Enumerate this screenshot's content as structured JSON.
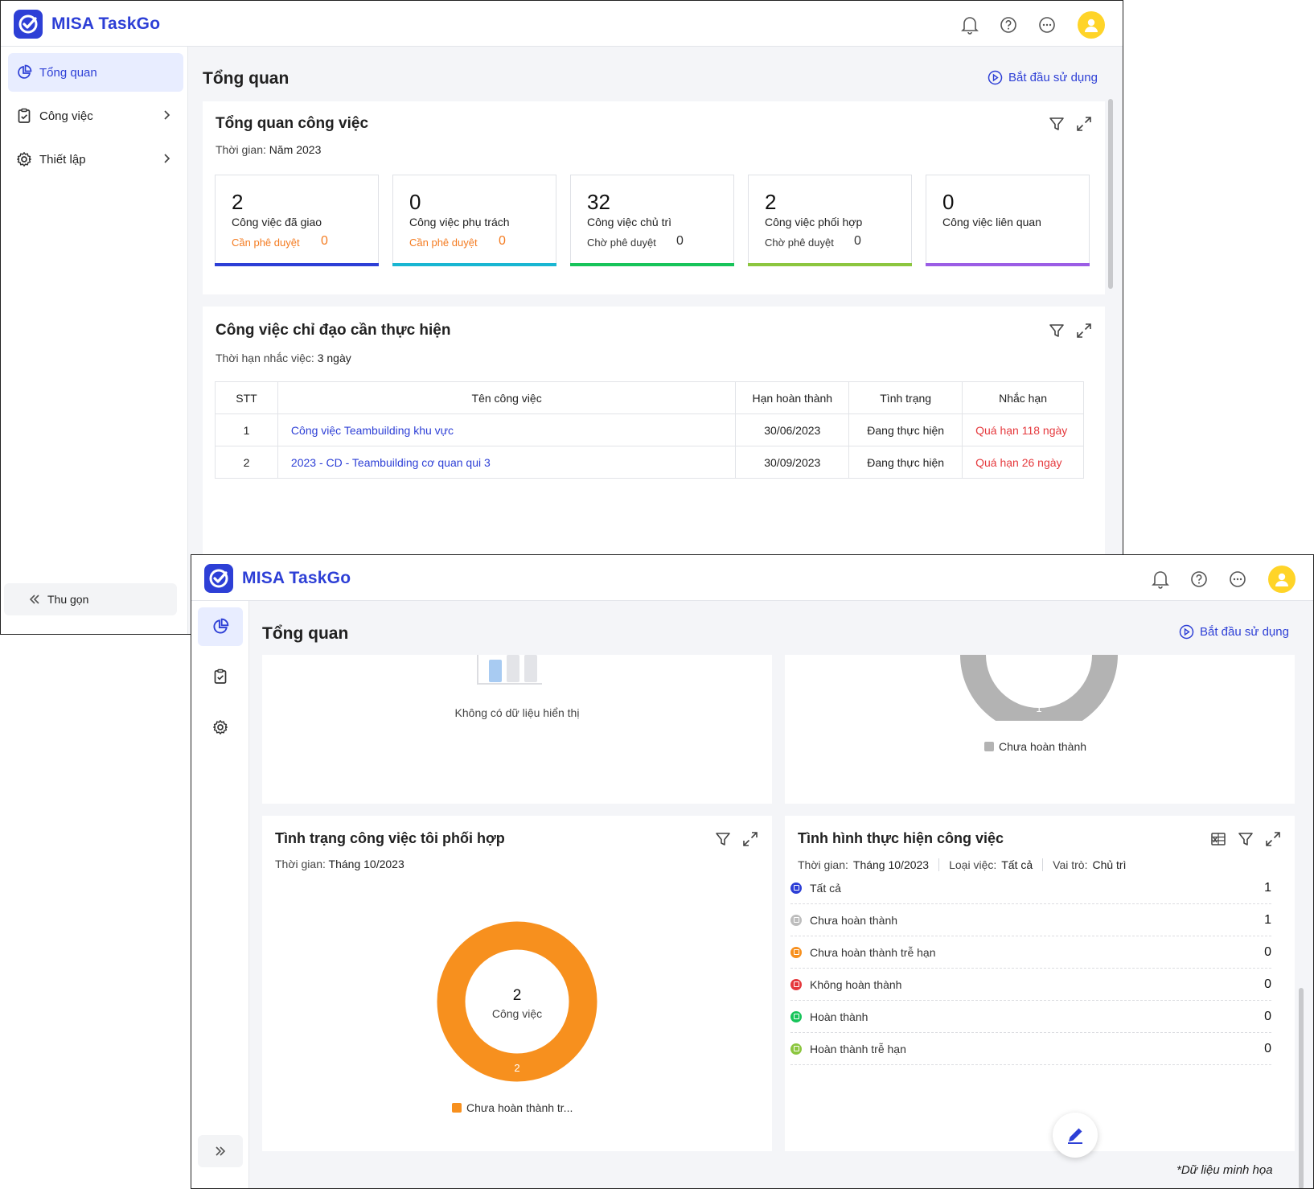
{
  "app": {
    "name": "MISA TaskGo"
  },
  "page": {
    "title": "Tổng quan",
    "start_link": "Bắt đầu sử dụng"
  },
  "sidebar": {
    "items": [
      {
        "label": "Tổng quan",
        "icon": "pie-chart-icon",
        "active": true
      },
      {
        "label": "Công việc",
        "icon": "clipboard-check-icon"
      },
      {
        "label": "Thiết lập",
        "icon": "gear-icon"
      }
    ],
    "collapse_label": "Thu gọn"
  },
  "overview": {
    "title": "Tổng quan công việc",
    "period_label": "Thời gian:",
    "period_value": "Năm 2023",
    "stats": [
      {
        "value": "2",
        "label": "Công việc đã giao",
        "sub_label": "Cần phê duyệt",
        "sub_value": "0",
        "sub_color": "#f47b20",
        "bar_color": "#2d3fd6"
      },
      {
        "value": "0",
        "label": "Công việc phụ trách",
        "sub_label": "Cần phê duyệt",
        "sub_value": "0",
        "sub_color": "#f47b20",
        "bar_color": "#19b6d2"
      },
      {
        "value": "32",
        "label": "Công việc chủ trì",
        "sub_label": "Chờ phê duyệt",
        "sub_value": "0",
        "sub_color": "#333333",
        "bar_color": "#17c45a"
      },
      {
        "value": "2",
        "label": "Công việc phối hợp",
        "sub_label": "Chờ phê duyệt",
        "sub_value": "0",
        "sub_color": "#333333",
        "bar_color": "#8cc63f"
      },
      {
        "value": "0",
        "label": "Công việc liên quan",
        "sub_label": "",
        "sub_value": "",
        "sub_color": "#333333",
        "bar_color": "#9b5de5"
      }
    ]
  },
  "directed": {
    "title": "Công việc chỉ đạo cần thực hiện",
    "reminder_label": "Thời hạn nhắc việc:",
    "reminder_value": "3 ngày",
    "columns": [
      "STT",
      "Tên công việc",
      "Hạn hoàn thành",
      "Tình trạng",
      "Nhắc hạn"
    ],
    "rows": [
      {
        "stt": "1",
        "name": "Công việc Teambuilding khu vực",
        "due": "30/06/2023",
        "status": "Đang thực hiện",
        "reminder": "Quá hạn 118 ngày"
      },
      {
        "stt": "2",
        "name": "2023 - CD - Teambuilding cơ quan qui 3",
        "due": "30/09/2023",
        "status": "Đang thực hiện",
        "reminder": "Quá hạn 26 ngày"
      }
    ]
  },
  "empty_card": {
    "message": "Không có dữ liệu hiển thị"
  },
  "partial_donut": {
    "value_label": "1",
    "legend": "Chưa hoàn thành",
    "color": "#b3b3b3"
  },
  "coop": {
    "title": "Tình trạng công việc tôi phối hợp",
    "period_label": "Thời gian:",
    "period_value": "Tháng 10/2023",
    "center_value": "2",
    "center_label": "Công việc",
    "slice_label": "2",
    "legend": "Chưa hoàn thành tr...",
    "color": "#f7901e"
  },
  "progress": {
    "title": "Tình hình thực hiện công việc",
    "filters": [
      {
        "label": "Thời gian:",
        "value": "Tháng 10/2023"
      },
      {
        "label": "Loại việc:",
        "value": "Tất cả"
      },
      {
        "label": "Vai trò:",
        "value": "Chủ trì"
      }
    ],
    "rows": [
      {
        "label": "Tất cả",
        "value": "1",
        "color": "#2d3fd6"
      },
      {
        "label": "Chưa hoàn thành",
        "value": "1",
        "color": "#bdbdbd"
      },
      {
        "label": "Chưa hoàn thành trễ hạn",
        "value": "0",
        "color": "#f7901e"
      },
      {
        "label": "Không hoàn thành",
        "value": "0",
        "color": "#e5393d"
      },
      {
        "label": "Hoàn thành",
        "value": "0",
        "color": "#17c45a"
      },
      {
        "label": "Hoàn thành trễ hạn",
        "value": "0",
        "color": "#8cc63f"
      }
    ]
  },
  "footnote": "*Dữ liệu minh họa",
  "colors": {
    "brand": "#2d3fd6",
    "late": "#e5393d",
    "avatar": "#ffd428"
  }
}
